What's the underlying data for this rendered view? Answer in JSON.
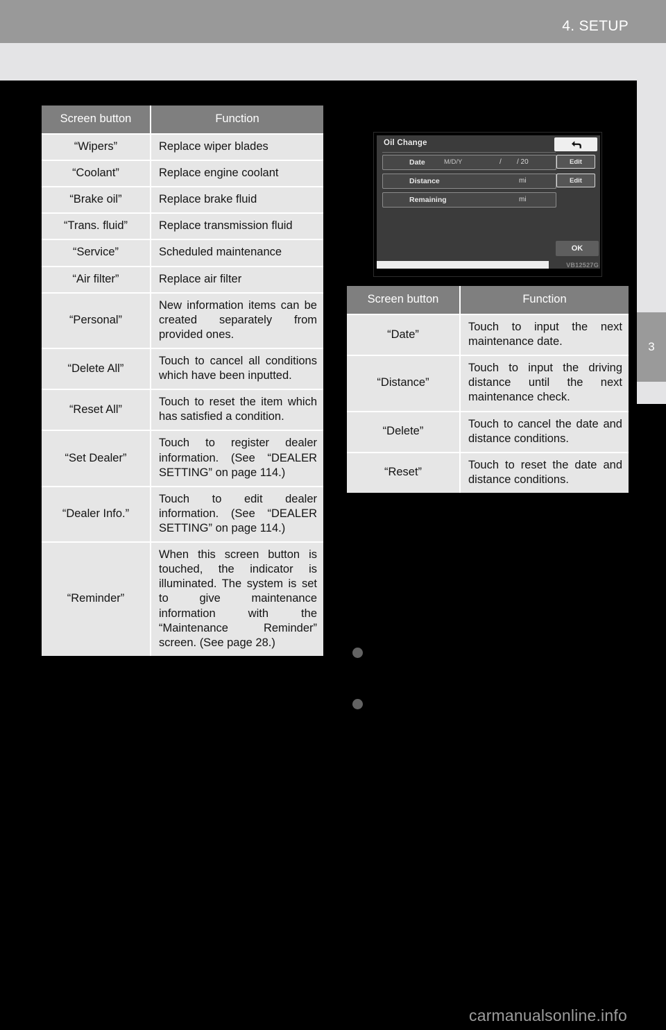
{
  "page": {
    "chapter_title": "4. SETUP",
    "side_tab_number": "3",
    "site_watermark": "carmanualsonline.info"
  },
  "left_table": {
    "headers": [
      "Screen button",
      "Function"
    ],
    "rows": [
      {
        "button": "“Wipers”",
        "function": "Replace wiper blades"
      },
      {
        "button": "“Coolant”",
        "function": "Replace engine coolant"
      },
      {
        "button": "“Brake oil”",
        "function": "Replace brake fluid"
      },
      {
        "button": "“Trans. fluid”",
        "function": "Replace transmission fluid"
      },
      {
        "button": "“Service”",
        "function": "Scheduled maintenance"
      },
      {
        "button": "“Air filter”",
        "function": "Replace air filter"
      },
      {
        "button": "“Personal”",
        "function": "New information items can be created separately from provided ones."
      },
      {
        "button": "“Delete All”",
        "function": "Touch to cancel all conditions which have been inputted."
      },
      {
        "button": "“Reset All”",
        "function": "Touch to reset the item which has satisfied a condition."
      },
      {
        "button": "“Set Dealer”",
        "function": "Touch to register dealer information. (See “DEALER SETTING” on page 114.)"
      },
      {
        "button": "“Dealer Info.”",
        "function": "Touch to edit dealer information. (See “DEALER SETTING” on page 114.)"
      },
      {
        "button": "“Reminder”",
        "function": "When this screen button is touched, the indicator is illuminated. The system is set to give maintenance information with the “Maintenance Reminder” screen. (See page 28.)"
      }
    ]
  },
  "right_table": {
    "headers": [
      "Screen button",
      "Function"
    ],
    "rows": [
      {
        "button": "“Date”",
        "function": "Touch to input the next maintenance date."
      },
      {
        "button": "“Distance”",
        "function": "Touch to input the driving distance until the next maintenance check."
      },
      {
        "button": "“Delete”",
        "function": "Touch to cancel the date and distance conditions."
      },
      {
        "button": "“Reset”",
        "function": "Touch to reset the date and distance conditions."
      }
    ]
  },
  "nav_screen": {
    "title": "Oil Change",
    "back_icon": "back-arrow-icon",
    "rows": [
      {
        "label": "Date",
        "format": "M/D/Y",
        "sep1": "/",
        "sep2": "/ 20",
        "edit_label": "Edit"
      },
      {
        "label": "Distance",
        "unit": "mi",
        "edit_label": "Edit"
      },
      {
        "label": "Remaining",
        "unit": "mi"
      }
    ],
    "ok_label": "OK",
    "code": "VB12527G"
  }
}
